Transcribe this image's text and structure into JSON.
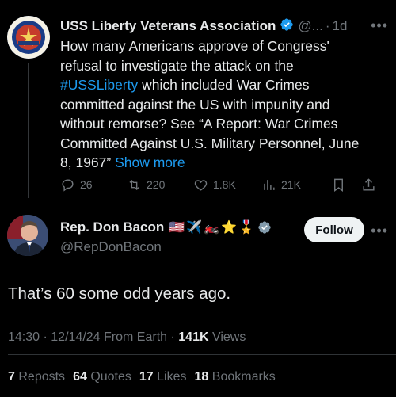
{
  "reply_tweet": {
    "author_name": "USS Liberty Veterans Association",
    "handle": "@...",
    "separator": "·",
    "age": "1d",
    "text_line_1": "How many Americans approve of Congress'",
    "text_line_2": "refusal to investigate the attack on the",
    "hashtag": "#USSLiberty",
    "text_line_3_rest": " which included War Crimes",
    "text_line_4": "committed against the US with impunity and",
    "text_line_5": "without remorse?  See “A Report: War Crimes",
    "text_line_6": "Committed Against U.S. Military Personnel, June",
    "text_line_7": "8, 1967”",
    "show_more": "Show more",
    "avatar_text_top": "USS LIBERTY",
    "avatar_text_bottom": "AGTR-5",
    "actions": {
      "replies": "26",
      "reposts": "220",
      "likes": "1.8K",
      "views": "21K"
    }
  },
  "main_tweet": {
    "author_name": "Rep. Don Bacon",
    "name_emojis": [
      "🇺🇸",
      "✈️",
      "🏍️",
      "⭐",
      "🎖️"
    ],
    "handle": "@RepDonBacon",
    "follow_label": "Follow",
    "text": "That’s 60 some odd years ago.",
    "meta": {
      "time": "14:30",
      "dot": "·",
      "date": "12/14/24",
      "source": "From Earth",
      "views_count": "141K",
      "views_label": "Views"
    },
    "stats": {
      "reposts_count": "7",
      "reposts_label": "Reposts",
      "quotes_count": "64",
      "quotes_label": "Quotes",
      "likes_count": "17",
      "likes_label": "Likes",
      "bookmarks_count": "18",
      "bookmarks_label": "Bookmarks"
    }
  },
  "colors": {
    "background": "#000000",
    "text": "#e7e9ea",
    "secondary": "#71767b",
    "link": "#1d9bf0",
    "follow_bg": "#eff3f4"
  }
}
